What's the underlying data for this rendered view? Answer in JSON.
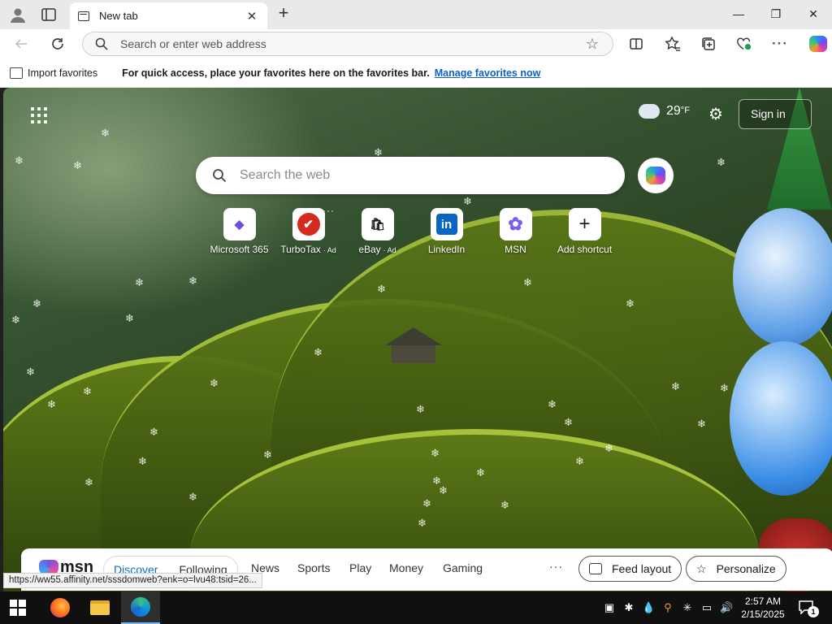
{
  "tab": {
    "title": "New tab",
    "close": "✕"
  },
  "window": {
    "minimize": "—",
    "maximize": "❐",
    "close": "✕",
    "new_tab": "+"
  },
  "toolbar": {
    "address_placeholder": "Search or enter web address"
  },
  "favorites_bar": {
    "import_label": "Import favorites",
    "tip": "For quick access, place your favorites here on the favorites bar.",
    "manage_link": "Manage favorites now"
  },
  "ntp": {
    "weather": {
      "temp": "29",
      "unit": "°F"
    },
    "settings_glyph": "⚙",
    "sign_in": "Sign in",
    "search_placeholder": "Search the web",
    "shortcuts": [
      {
        "label": "Microsoft 365",
        "ad": "",
        "glyph": "◆",
        "color": "#6f4ce0"
      },
      {
        "label": "TurboTax",
        "ad": "· Ad",
        "glyph": "✔",
        "color": "#d52b1e"
      },
      {
        "label": "eBay",
        "ad": "· Ad",
        "glyph": "🛍",
        "color": "#333333"
      },
      {
        "label": "LinkedIn",
        "ad": "",
        "glyph": "in",
        "color": "#0a66c2"
      },
      {
        "label": "MSN",
        "ad": "",
        "glyph": "✿",
        "color": "#7b5cf0"
      },
      {
        "label": "Add shortcut",
        "ad": "",
        "glyph": "+",
        "color": "#333333"
      }
    ]
  },
  "feed": {
    "logo_text": "msn",
    "tabs": [
      "Discover",
      "Following"
    ],
    "categories": [
      "News",
      "Sports",
      "Play",
      "Money",
      "Gaming"
    ],
    "more": "···",
    "feed_layout": "Feed layout",
    "personalize": "Personalize"
  },
  "status_url": "https://ww55.affinity.net/sssdomweb?enk=o=lvu48:tsid=26...",
  "taskbar": {
    "time": "2:57 AM",
    "date": "2/15/2025",
    "notification_count": "1"
  }
}
